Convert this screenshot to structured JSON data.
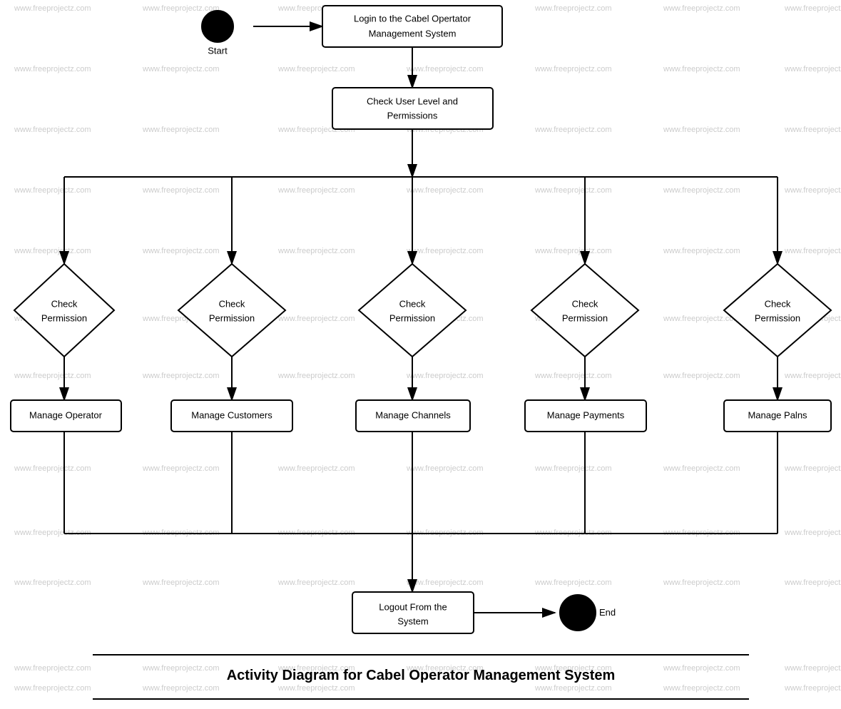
{
  "diagram": {
    "title": "Activity Diagram for Cabel Operator Management System",
    "nodes": {
      "start": {
        "label": "Start",
        "type": "circle"
      },
      "login": {
        "label": "Login to the Cabel Opertator\nManagement System",
        "type": "rect"
      },
      "checkUserLevel": {
        "label": "Check User Level and\nPermissions",
        "type": "rect"
      },
      "checkPerm1": {
        "label": "Check\nPermission",
        "type": "diamond"
      },
      "checkPerm2": {
        "label": "Check\nPermission",
        "type": "diamond"
      },
      "checkPerm3": {
        "label": "Check\nPermission",
        "type": "diamond"
      },
      "checkPerm4": {
        "label": "Check\nPermission",
        "type": "diamond"
      },
      "checkPerm5": {
        "label": "Check\nPermission",
        "type": "diamond"
      },
      "manageOperator": {
        "label": "Manage Operator",
        "type": "rect"
      },
      "manageCustomers": {
        "label": "Manage Customers",
        "type": "rect"
      },
      "manageChannels": {
        "label": "Manage Channels",
        "type": "rect"
      },
      "managePayments": {
        "label": "Manage Payments",
        "type": "rect"
      },
      "managePlans": {
        "label": "Manage Palns",
        "type": "rect"
      },
      "logout": {
        "label": "Logout From the\nSystem",
        "type": "rect"
      },
      "end": {
        "label": "End",
        "type": "circle"
      }
    },
    "watermark": "www.freeprojectz.com"
  }
}
